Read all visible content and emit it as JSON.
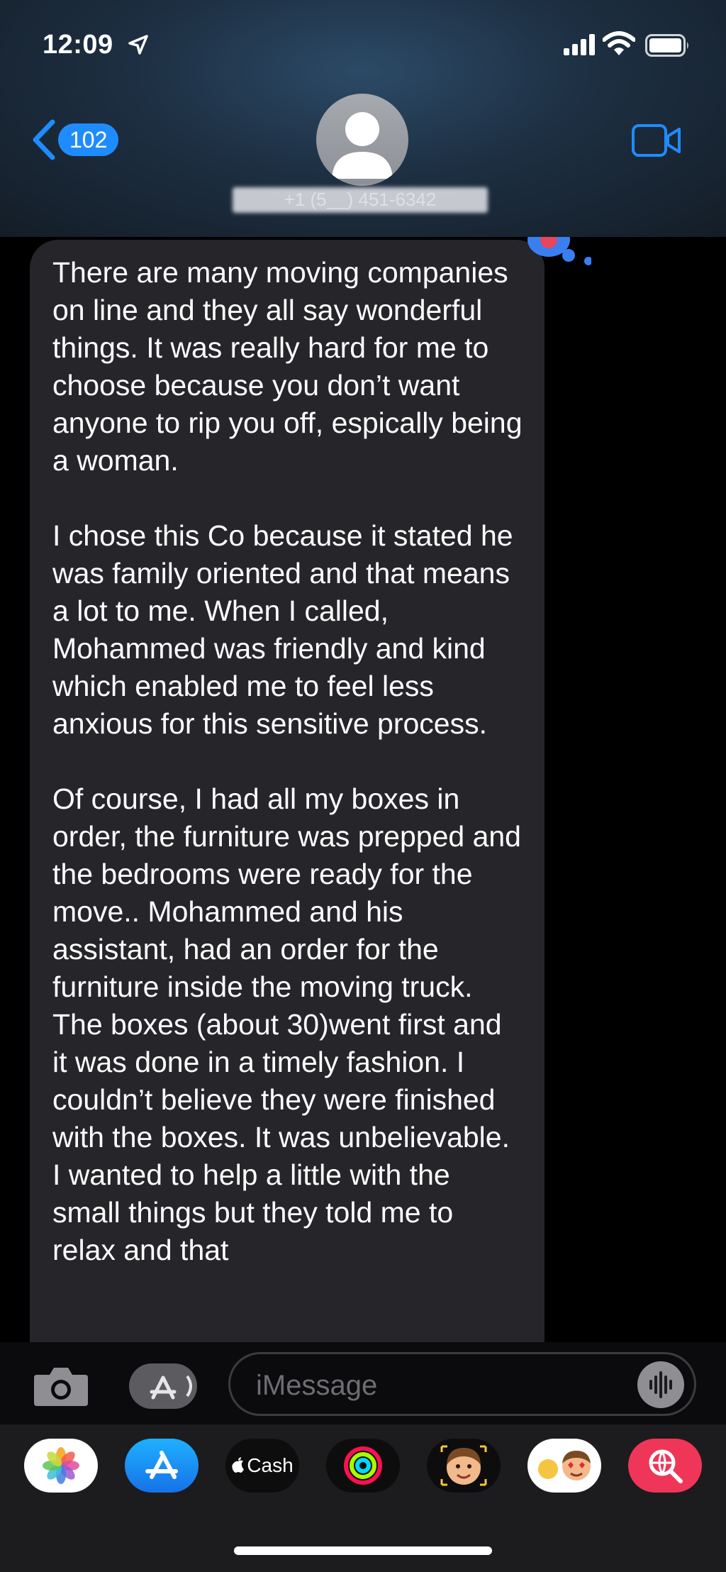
{
  "status_bar": {
    "time": "12:09"
  },
  "header": {
    "back_count": "102",
    "contact_label": "+1 (5__) 451-6342"
  },
  "message": {
    "paragraphs": [
      "There are many moving companies on line and they all say wonderful things. It was really hard for me to choose because you don’t want anyone to rip you off, espically being a woman.",
      "I chose this Co because it stated he was family oriented and that means a lot to me. When I called, Mohammed was friendly and kind which enabled me to feel less anxious for this sensitive process.",
      "Of course, I had all my boxes in order, the furniture was prepped and the bedrooms were ready for the move.. Mohammed and his assistant, had an order for the furniture inside the moving truck. The boxes (about 30)went first and it was done in a timely fashion. I couldn’t believe they were finished with the boxes. It was unbelievable. I wanted to help a little with the small things but they told me to relax and that"
    ]
  },
  "input": {
    "placeholder": "iMessage"
  },
  "app_drawer": {
    "cash_label": "Cash",
    "apps": [
      "photos-icon",
      "app-store-icon",
      "apple-cash-icon",
      "fitness-icon",
      "memoji-icon",
      "memoji-stickers-icon",
      "images-search-icon"
    ]
  },
  "colors": {
    "accent": "#1e8cff",
    "bubble": "#26252a",
    "background": "#000000"
  }
}
